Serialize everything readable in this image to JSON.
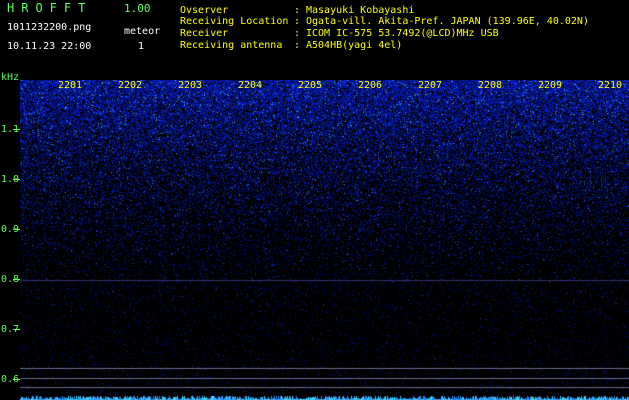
{
  "header": {
    "app_title": "HROFFT",
    "app_version": "1.00",
    "file_name": "1011232200.png",
    "meteor_label": "meteor",
    "meteor_count": "1",
    "timestamp": "10.11.23 22:00"
  },
  "station_info": [
    {
      "key": "Ovserver",
      "value": "Masayuki Kobayashi"
    },
    {
      "key": "Receiving Location",
      "value": "Ogata-vill. Akita-Pref. JAPAN (139.96E, 40.02N)"
    },
    {
      "key": "Receiver",
      "value": "ICOM IC-575 53.7492(@LCD)MHz USB"
    },
    {
      "key": "Receiving antenna",
      "value": "A504HB(yagi 4el)"
    }
  ],
  "separator": ":",
  "axis": {
    "unit": "kHz",
    "freq_labels": [
      "1.1",
      "1.0",
      "0.9",
      "0.8",
      "0.7",
      "0.6"
    ],
    "time_labels": [
      "2201",
      "2202",
      "2203",
      "2204",
      "2205",
      "2206",
      "2207",
      "2208",
      "2209",
      "2210"
    ]
  },
  "colors": {
    "text_green": "#5cff5c",
    "text_white": "#ffffff",
    "text_yellow": "#ffff00",
    "background": "#000000",
    "signal_blue": "#1e3cff",
    "signal_cyan": "#40d0ff",
    "marker_line": "#8080a0"
  }
}
